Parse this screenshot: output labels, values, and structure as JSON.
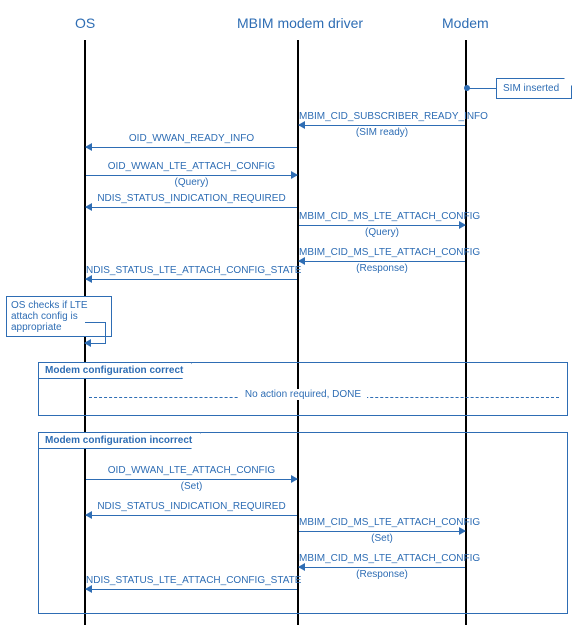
{
  "lanes": {
    "os": "OS",
    "driver": "MBIM modem driver",
    "modem": "Modem"
  },
  "notes": {
    "sim_inserted": "SIM inserted",
    "os_check": "OS checks if LTE attach config is appropriate"
  },
  "msgs": {
    "sub_ready": "MBIM_CID_SUBSCRIBER_READY_INFO",
    "sub_ready_sub": "(SIM ready)",
    "oid_ready": "OID_WWAN_READY_INFO",
    "oid_attach_query": "OID_WWAN_LTE_ATTACH_CONFIG",
    "oid_attach_query_sub": "(Query)",
    "ndis_ind_req": "NDIS_STATUS_INDICATION_REQUIRED",
    "mbim_attach_query": "MBIM_CID_MS_LTE_ATTACH_CONFIG",
    "mbim_attach_query_sub": "(Query)",
    "mbim_attach_resp": "MBIM_CID_MS_LTE_ATTACH_CONFIG",
    "mbim_attach_resp_sub": "(Response)",
    "ndis_attach_state": "NDIS_STATUS_LTE_ATTACH_CONFIG_STATE",
    "oid_attach_set": "OID_WWAN_LTE_ATTACH_CONFIG",
    "oid_attach_set_sub": "(Set)",
    "ndis_ind_req2": "NDIS_STATUS_INDICATION_REQUIRED",
    "mbim_attach_set": "MBIM_CID_MS_LTE_ATTACH_CONFIG",
    "mbim_attach_set_sub": "(Set)",
    "mbim_attach_resp2": "MBIM_CID_MS_LTE_ATTACH_CONFIG",
    "mbim_attach_resp2_sub": "(Response)",
    "ndis_attach_state2": "NDIS_STATUS_LTE_ATTACH_CONFIG_STATE"
  },
  "frags": {
    "correct": "Modem configuration correct",
    "correct_text": "No action required, DONE",
    "incorrect": "Modem configuration incorrect"
  }
}
